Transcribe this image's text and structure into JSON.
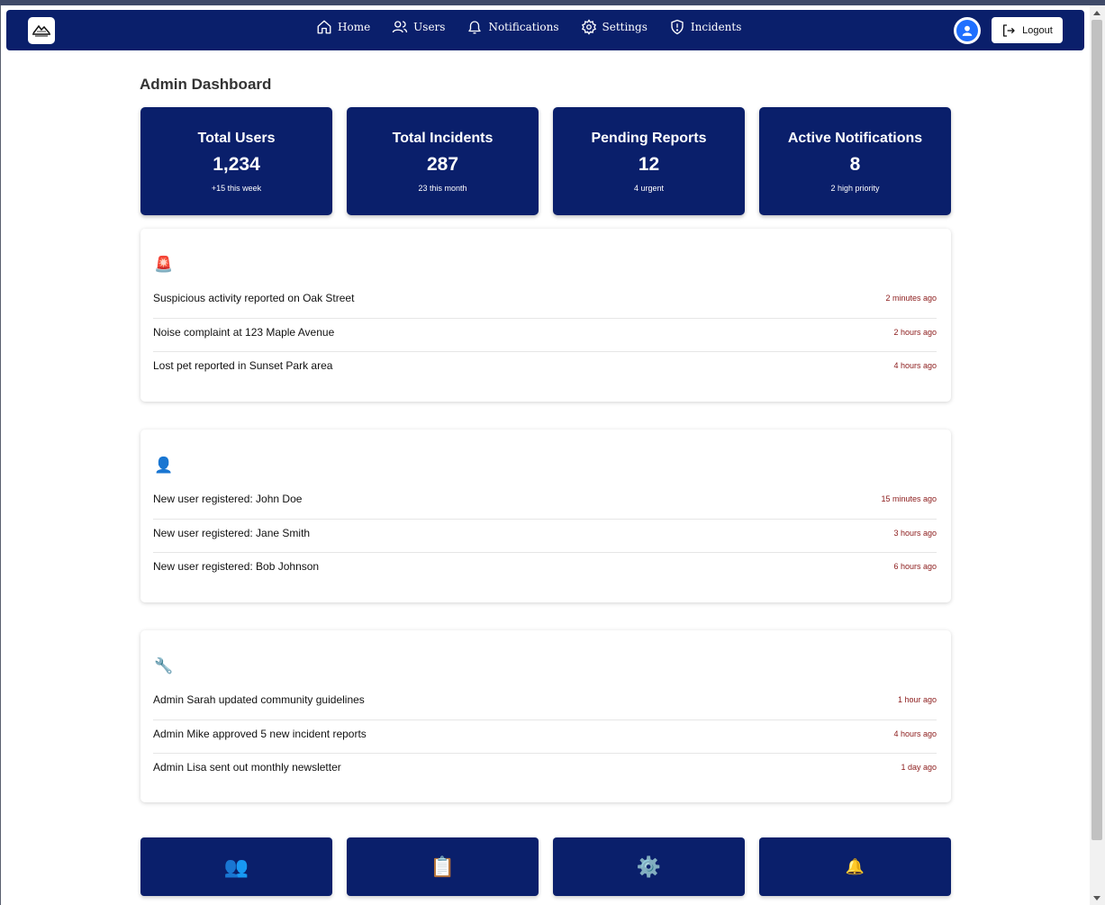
{
  "nav": {
    "links": [
      {
        "label": "Home",
        "icon": "home-icon"
      },
      {
        "label": "Users",
        "icon": "users-icon"
      },
      {
        "label": "Notifications",
        "icon": "bell-icon"
      },
      {
        "label": "Settings",
        "icon": "gear-icon"
      },
      {
        "label": "Incidents",
        "icon": "shield-icon"
      }
    ],
    "logout_label": "Logout"
  },
  "page": {
    "title": "Admin Dashboard"
  },
  "stats": [
    {
      "label": "Total Users",
      "value": "1,234",
      "sub": "+15 this week"
    },
    {
      "label": "Total Incidents",
      "value": "287",
      "sub": "23 this month"
    },
    {
      "label": "Pending Reports",
      "value": "12",
      "sub": "4 urgent"
    },
    {
      "label": "Active Notifications",
      "value": "8",
      "sub": "2 high priority"
    }
  ],
  "panels": {
    "incidents": {
      "icon": "🚨",
      "items": [
        {
          "text": "Suspicious activity reported on Oak Street",
          "time": "2 minutes ago"
        },
        {
          "text": "Noise complaint at 123 Maple Avenue",
          "time": "2 hours ago"
        },
        {
          "text": "Lost pet reported in Sunset Park area",
          "time": "4 hours ago"
        }
      ]
    },
    "users": {
      "icon": "👤",
      "items": [
        {
          "text": "New user registered: John Doe",
          "time": "15 minutes ago"
        },
        {
          "text": "New user registered: Jane Smith",
          "time": "3 hours ago"
        },
        {
          "text": "New user registered: Bob Johnson",
          "time": "6 hours ago"
        }
      ]
    },
    "admin": {
      "icon": "🔧",
      "items": [
        {
          "text": "Admin Sarah updated community guidelines",
          "time": "1 hour ago"
        },
        {
          "text": "Admin Mike approved 5 new incident reports",
          "time": "4 hours ago"
        },
        {
          "text": "Admin Lisa sent out monthly newsletter",
          "time": "1 day ago"
        }
      ]
    }
  },
  "quick_actions": [
    {
      "icon": "👥",
      "name": "users-icon"
    },
    {
      "icon": "📋",
      "name": "clipboard-icon"
    },
    {
      "icon": "⚙️",
      "name": "gear-icon"
    },
    {
      "icon": "🔔",
      "name": "bell-icon"
    }
  ],
  "colors": {
    "navy": "#0a1f6b",
    "time_red": "#8b1a1a",
    "avatar_blue": "#1f6fff"
  }
}
